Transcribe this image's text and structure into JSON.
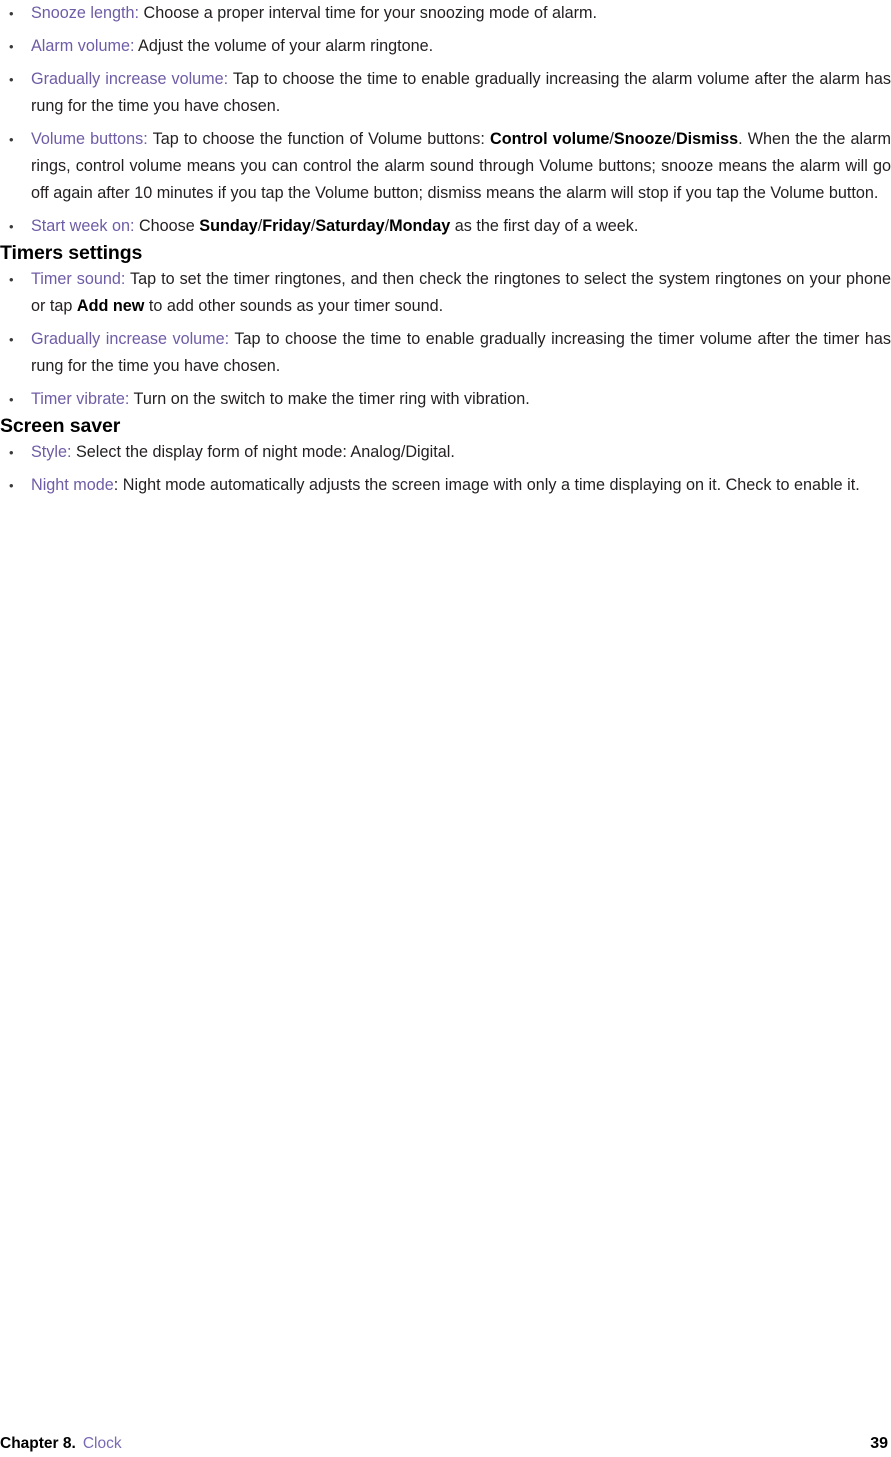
{
  "document": {
    "type": "user-manual-page",
    "colors": {
      "term_purple": "#6f5ca6",
      "body_text": "#231f20",
      "heading_black": "#000000",
      "footer_topic_purple": "#7a6ab3",
      "background": "#ffffff"
    }
  },
  "alarm_settings": {
    "items": [
      {
        "term": "Snooze length:",
        "body_1": " Choose a proper interval time for your snoozing mode of alarm."
      },
      {
        "term": "Alarm volume:",
        "body_1": " Adjust the volume of your alarm ringtone."
      },
      {
        "term": "Gradually increase volume:",
        "body_1": " Tap to choose the time to enable gradually increasing the alarm volume after the alarm has rung for the time you have chosen."
      },
      {
        "term": "Volume buttons:",
        "body_1": " Tap to choose the function of Volume buttons: ",
        "bold_1": "Control volume",
        "slash_1": "/",
        "bold_2": "Snooze",
        "slash_2": "/",
        "bold_3": "Dismiss",
        "body_2": ". When the the alarm rings, control volume means you can control the alarm sound through Volume buttons; snooze means the alarm will go off again after 10 minutes if you tap the Volume button; dismiss means the alarm will stop if you tap the Volume button."
      },
      {
        "term": "Start week on:",
        "body_1": " Choose ",
        "bold_1": "Sunday",
        "slash_1": "/",
        "bold_2": "Friday",
        "slash_2": "/",
        "bold_3": "Saturday",
        "slash_3": "/",
        "bold_4": "Monday",
        "body_2": " as the first day of a week."
      }
    ]
  },
  "timers_settings": {
    "heading": "Timers settings",
    "items": [
      {
        "term": "Timer sound:",
        "body_1": " Tap to set the timer ringtones, and then check the ringtones to select the system ringtones on your phone or tap ",
        "bold_1": "Add new",
        "body_2": " to add other sounds as your timer sound."
      },
      {
        "term": "Gradually increase volume:",
        "body_1": " Tap to choose the time to enable gradually increasing the timer volume after the timer  has rung for the time you have chosen."
      },
      {
        "term": "Timer vibrate:",
        "body_1": " Turn on the switch to make the timer ring with vibration."
      }
    ]
  },
  "screen_saver": {
    "heading": "Screen saver",
    "items": [
      {
        "term": "Style:",
        "body_1": " Select the display form of night mode: Analog/Digital."
      },
      {
        "term": "Night mode",
        "body_1": ": Night mode automatically adjusts the screen image with only a time displaying on it. Check to enable it."
      }
    ]
  },
  "footer": {
    "chapter": "Chapter 8",
    "separator": ".",
    "topic": "Clock",
    "page_number": "39"
  }
}
